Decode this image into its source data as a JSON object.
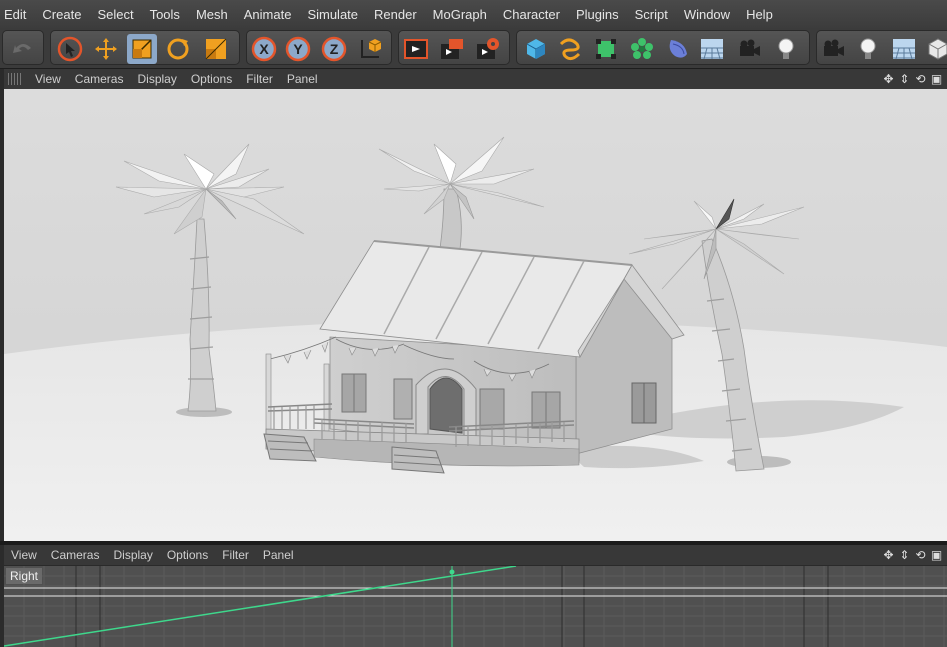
{
  "menu": [
    "Edit",
    "Create",
    "Select",
    "Tools",
    "Mesh",
    "Animate",
    "Simulate",
    "Render",
    "MoGraph",
    "Character",
    "Plugins",
    "Script",
    "Window",
    "Help"
  ],
  "toolbar": {
    "icons": [
      "undo-icon",
      "live-selection-icon",
      "move-icon",
      "scale-icon",
      "rotate-icon",
      "recent-tool-icon",
      "x-axis-icon",
      "y-axis-icon",
      "z-axis-icon",
      "world-coordinate-icon",
      "render-view-icon",
      "render-picture-viewer-icon",
      "render-settings-icon",
      "cube-icon",
      "spline-icon",
      "nurbs-icon",
      "array-icon",
      "deformer-icon",
      "floor-icon",
      "camera-icon",
      "light-icon",
      "camera-icon-2",
      "light-icon-2",
      "floor-icon-2",
      "cube-icon-2"
    ],
    "axis_labels": {
      "x": "X",
      "y": "Y",
      "z": "Z"
    },
    "colors": {
      "accent_orange": "#f0a020",
      "active_blue": "#8ca8c9"
    }
  },
  "viewport_top": {
    "menu": [
      "View",
      "Cameras",
      "Display",
      "Options",
      "Filter",
      "Panel"
    ],
    "scene": "palm trees around a house with porch"
  },
  "viewport_bottom": {
    "menu": [
      "View",
      "Cameras",
      "Display",
      "Options",
      "Filter",
      "Panel"
    ],
    "camera_label": "Right",
    "colors": {
      "curve": "#3ed88c",
      "grid": "#5b5b5b"
    }
  }
}
